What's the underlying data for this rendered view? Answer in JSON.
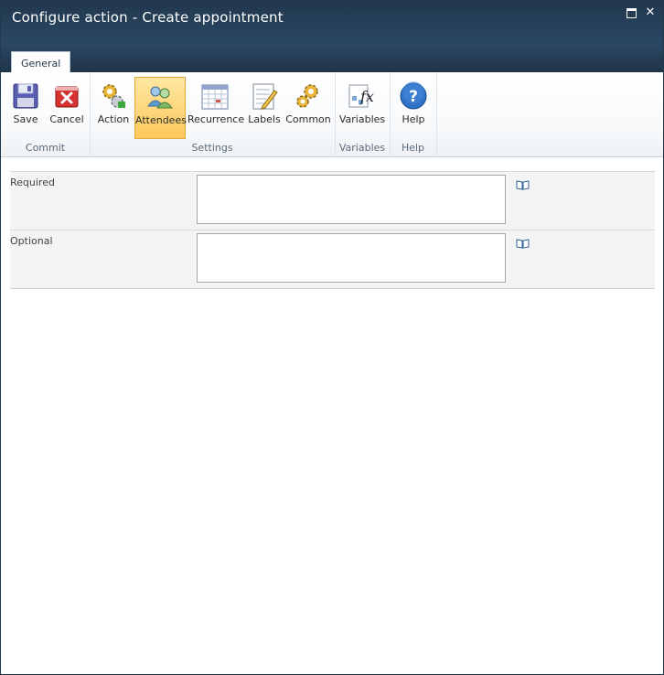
{
  "window": {
    "title": "Configure action - Create appointment"
  },
  "tabs": [
    {
      "label": "General"
    }
  ],
  "ribbon": {
    "groups": [
      {
        "label": "Commit",
        "buttons": [
          {
            "label": "Save"
          },
          {
            "label": "Cancel"
          }
        ]
      },
      {
        "label": "Settings",
        "buttons": [
          {
            "label": "Action"
          },
          {
            "label": "Attendees"
          },
          {
            "label": "Recurrence"
          },
          {
            "label": "Labels"
          },
          {
            "label": "Common"
          }
        ]
      },
      {
        "label": "Variables",
        "buttons": [
          {
            "label": "Variables"
          }
        ]
      },
      {
        "label": "Help",
        "buttons": [
          {
            "label": "Help"
          }
        ]
      }
    ],
    "active_button": "Attendees"
  },
  "form": {
    "fields": [
      {
        "label": "Required",
        "value": ""
      },
      {
        "label": "Optional",
        "value": ""
      }
    ]
  },
  "colors": {
    "titlebar": "#2a4763",
    "active_button": "#fcc95a"
  }
}
